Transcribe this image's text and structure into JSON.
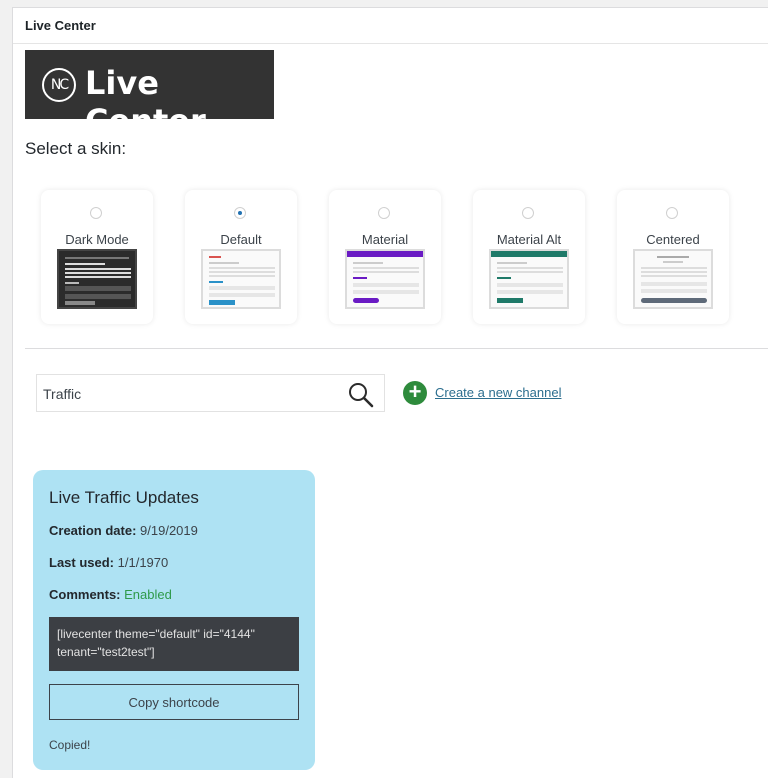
{
  "panel": {
    "title": "Live Center"
  },
  "logo": {
    "mark": "NC",
    "text": "Live Center"
  },
  "skins": {
    "heading": "Select a skin:",
    "items": [
      {
        "label": "Dark Mode",
        "selected": false
      },
      {
        "label": "Default",
        "selected": true
      },
      {
        "label": "Material",
        "selected": false
      },
      {
        "label": "Material Alt",
        "selected": false
      },
      {
        "label": "Centered",
        "selected": false
      }
    ]
  },
  "search": {
    "value": "Traffic"
  },
  "create_link": "Create a new channel",
  "channel": {
    "title": "Live Traffic Updates",
    "creation_label": "Creation date:",
    "creation_value": "9/19/2019",
    "last_used_label": "Last used:",
    "last_used_value": "1/1/1970",
    "comments_label": "Comments:",
    "comments_value": "Enabled",
    "shortcode": "[livecenter theme=\"default\" id=\"4144\" tenant=\"test2test\"]",
    "copy_label": "Copy shortcode",
    "copied_text": "Copied!"
  },
  "colors": {
    "accent_blue": "#2271b1",
    "card_bg": "#aee2f3",
    "enabled_green": "#2e9a4a",
    "add_green": "#2e8b3c",
    "material_purple": "#6a1bc4",
    "material_alt_teal": "#1f7a69",
    "default_blue": "#2a91c8"
  }
}
